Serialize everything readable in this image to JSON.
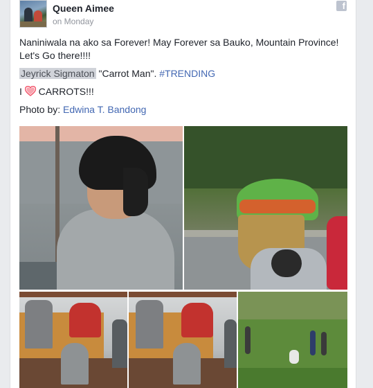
{
  "post": {
    "author": "Queen Aimee",
    "timestamp": "on Monday",
    "line1": "Naniniwala na ako sa Forever! May Forever sa Bauko, Mountain Province! Let's Go there!!!!",
    "tagged_name": "Jeyrick Sigmaton",
    "line2_rest": " \"Carrot Man\". ",
    "hashtag": "#TRENDING",
    "love_prefix": "I ",
    "love_suffix": " CARROTS!!!",
    "photo_by_label": "Photo by: ",
    "photographer": "Edwina T. Bandong"
  },
  "icons": {
    "share_source": "facebook-icon",
    "heart": "heart-icon"
  },
  "colors": {
    "link": "#4267b2",
    "meta": "#90949c",
    "heart": "#f25268",
    "highlight": "#d0d3d9"
  },
  "photos": [
    {
      "name": "photo-boy-portrait"
    },
    {
      "name": "photo-carrying-basket"
    },
    {
      "name": "photo-truck-unloading-1"
    },
    {
      "name": "photo-truck-unloading-2"
    },
    {
      "name": "photo-carrot-field"
    }
  ]
}
